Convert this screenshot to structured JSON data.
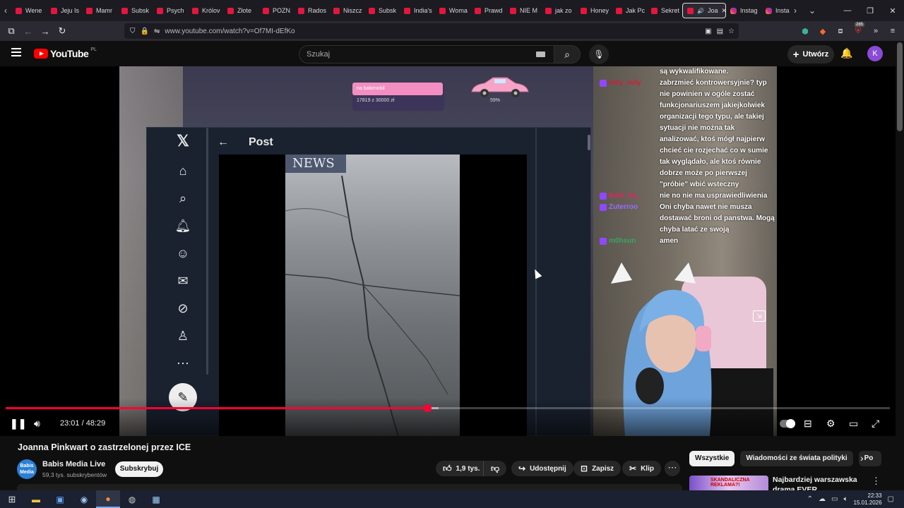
{
  "browser": {
    "tabs": [
      {
        "label": "Wene",
        "icon": "youtube-icon"
      },
      {
        "label": "Jeju Is",
        "icon": "youtube-icon"
      },
      {
        "label": "Mamr",
        "icon": "youtube-icon"
      },
      {
        "label": "Subsk",
        "icon": "youtube-icon"
      },
      {
        "label": "Psych",
        "icon": "youtube-icon"
      },
      {
        "label": "Królov",
        "icon": "youtube-icon"
      },
      {
        "label": "Złote",
        "icon": "youtube-icon"
      },
      {
        "label": "POZN",
        "icon": "youtube-icon"
      },
      {
        "label": "Rados",
        "icon": "youtube-icon"
      },
      {
        "label": "Niszcz",
        "icon": "youtube-icon"
      },
      {
        "label": "Subsk",
        "icon": "youtube-icon"
      },
      {
        "label": "India's",
        "icon": "youtube-icon"
      },
      {
        "label": "Woma",
        "icon": "youtube-icon"
      },
      {
        "label": "Prawd",
        "icon": "youtube-icon"
      },
      {
        "label": "NIE M",
        "icon": "youtube-icon"
      },
      {
        "label": "jak zo",
        "icon": "youtube-icon"
      },
      {
        "label": "Honey",
        "icon": "youtube-icon"
      },
      {
        "label": "Jak Pc",
        "icon": "youtube-icon"
      },
      {
        "label": "Sekret",
        "icon": "youtube-icon"
      }
    ],
    "active_tab": {
      "label": "Joa",
      "icon": "youtube-icon"
    },
    "extra_tabs": [
      {
        "label": "Instag",
        "icon": "instagram-icon"
      },
      {
        "label": "Insta",
        "icon": "instagram-icon"
      }
    ],
    "url": "www.youtube.com/watch?v=Of7MI-dEfKo",
    "extension_badge": "285"
  },
  "youtube": {
    "logo_text": "YouTube",
    "region": "PL",
    "search_placeholder": "Szukaj",
    "create_label": "Utwórz",
    "avatar_letter": "K"
  },
  "video": {
    "overlay": {
      "donation_label": "na babimobil",
      "donation_amount": "17819 z 30000 zł",
      "donation_percent": "59%",
      "post_title": "Post",
      "news_label": "NEWS"
    },
    "chat": [
      {
        "user": "",
        "user_color": "#ffffff",
        "text": "są wykwalifikowane."
      },
      {
        "user": "mily_mily",
        "user_color": "#cc2233",
        "text": "zabrzmieć kontrowersyjnie? typ"
      },
      {
        "user": "",
        "user_color": "#ffffff",
        "text": "nie powinien w ogóle zostać"
      },
      {
        "user": "",
        "user_color": "#ffffff",
        "text": "funkcjonariuszem jakiejkolwiek"
      },
      {
        "user": "",
        "user_color": "#ffffff",
        "text": "organizacji tego typu, ale takiej"
      },
      {
        "user": "",
        "user_color": "#ffffff",
        "text": "sytuacji nie można tak"
      },
      {
        "user": "",
        "user_color": "#ffffff",
        "text": "analizować, ktoś mógł najpierw"
      },
      {
        "user": "",
        "user_color": "#ffffff",
        "text": "chcieć cie rozjechać co w sumie"
      },
      {
        "user": "",
        "user_color": "#ffffff",
        "text": "tak wyglądało, ale ktoś równie"
      },
      {
        "user": "",
        "user_color": "#ffffff",
        "text": "dobrze może po pierwszej"
      },
      {
        "user": "",
        "user_color": "#ffffff",
        "text": "\"próbie\" wbić wsteczny"
      },
      {
        "user": "kizik_ha...",
        "user_color": "#e0255a",
        "text": "nie no nie ma usprawiedliwienia"
      },
      {
        "user": "Zuterroo",
        "user_color": "#9b6bff",
        "text": "Oni chyba nawet nie musza"
      },
      {
        "user": "",
        "user_color": "#ffffff",
        "text": "dostawać broni od panstwa. Mogą"
      },
      {
        "user": "",
        "user_color": "#ffffff",
        "text": "chyba latać ze swoją"
      },
      {
        "user": "m0hsun",
        "user_color": "#3aa55d",
        "text": "amen"
      }
    ],
    "progress_played": 0.477,
    "progress_loaded": 0.49,
    "time_current": "23:01",
    "time_separator": "/",
    "time_total": "48:29"
  },
  "meta": {
    "title": "Joanna Pinkwart o zastrzelonej przez ICE",
    "channel_avatar_text": "Babis Media",
    "channel_name": "Babis Media Live",
    "subscribers": "59,3 tys. subskrybentów",
    "subscribe_label": "Subskrybuj",
    "likes": "1,9 tys.",
    "share_label": "Udostępnij",
    "save_label": "Zapisz",
    "clip_label": "Klip"
  },
  "recommendations": {
    "chips": [
      "Wszystkie",
      "Wiadomości ze świata polityki",
      "Po"
    ],
    "first_title": "Najbardziej warszawska drama EVER",
    "first_thumb_text": "SKANDALICZNA REKLAMA?!"
  },
  "taskbar": {
    "time": "22:33",
    "date": "15.01.2026"
  },
  "colors": {
    "accent_red": "#ff0033",
    "yt_background": "#0f0f0f"
  }
}
